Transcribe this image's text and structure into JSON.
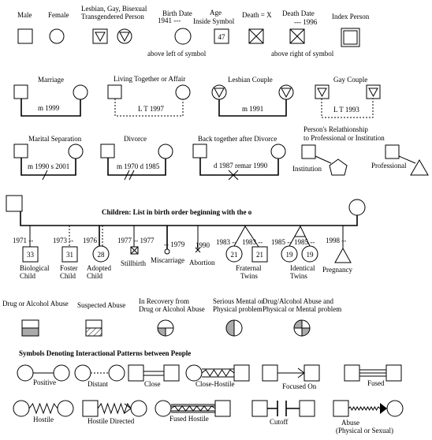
{
  "individuals": {
    "male": "Male",
    "female": "Female",
    "lgbt_line1": "Lesbian, Gay, Bisexual",
    "lgbt_line2": "Transgendered Person",
    "birth_date": "Birth Date",
    "birth_year": "1941 ---",
    "birth_note": "above left of symbol",
    "age_line1": "Age",
    "age_line2": "Inside Symbol",
    "age_value": "47",
    "death": "Death = X",
    "death_date": "Death Date",
    "death_year": "--- 1996",
    "death_note": "above right of symbol",
    "index_person": "Index Person"
  },
  "couples": {
    "marriage": "Marriage",
    "marriage_date": "m 1999",
    "living_together": "Living Together or Affair",
    "living_together_date": "L T 1997",
    "lesbian_couple": "Lesbian Couple",
    "lesbian_date": "m 1991",
    "gay_couple": "Gay Couple",
    "gay_date": "L T 1993",
    "separation": "Marital Separation",
    "separation_date": "m 1990 s 2001",
    "divorce": "Divorce",
    "divorce_date": "m 1970 d 1985",
    "back_together": "Back together after Divorce",
    "back_together_date": "d 1987 remar 1990",
    "professional_line1": "Person's Relathionship",
    "professional_line2": "to Professional or Institution",
    "institution": "Institution",
    "professional": "Professional"
  },
  "children": {
    "title": "Children: List in birth order beginning with the o",
    "bio": {
      "year": "1971 --",
      "age": "33",
      "label1": "Biological",
      "label2": "Child"
    },
    "foster": {
      "year": "1973 --",
      "age": "31",
      "label1": "Foster",
      "label2": "Child"
    },
    "adopted": {
      "year": "1976",
      "age": "28",
      "label1": "Adopted",
      "label2": "Child"
    },
    "stillbirth": {
      "year": "1977 -- 1977",
      "label": "Stillbirth"
    },
    "miscarriage": {
      "year": "-- 1979",
      "label": "Miscarriage"
    },
    "abortion": {
      "year": "1990",
      "label": "Abortion"
    },
    "fraternal": {
      "year1": "1983 --",
      "year2": "1983 --",
      "age1": "21",
      "age2": "21",
      "label1": "Fraternal",
      "label2": "Twins"
    },
    "identical": {
      "year1": "1985 --",
      "year2": "1985 --",
      "age1": "19",
      "age2": "19",
      "label1": "Identical",
      "label2": "Twins"
    },
    "pregnancy": {
      "year": "1998 --",
      "label": "Pregnancy"
    }
  },
  "conditions": {
    "drug": "Drug or Alcohol Abuse",
    "suspected": "Suspected Abuse",
    "recovery1": "In Recovery from",
    "recovery2": "Drug or Alcohol Abuse",
    "serious1": "Serious Mental or",
    "serious2": "Physical problem",
    "combined1": "Drug/Alcohol Abuse and",
    "combined2": "Physical or Mental problem",
    "shade_color": "#aaaaaa"
  },
  "interactions": {
    "title": "Symbols Denoting Interactional Patterns between People",
    "positive": "Positive",
    "distant": "Distant",
    "close": "Close",
    "close_hostile": "Close-Hostile",
    "focused_on": "Focused On",
    "fused": "Fused",
    "hostile": "Hostile",
    "hostile_directed": "Hostile Directed",
    "fused_hostile": "Fused Hostile",
    "cutoff": "Cutoff",
    "abuse1": "Abuse",
    "abuse2": "(Physical or Sexual)"
  }
}
